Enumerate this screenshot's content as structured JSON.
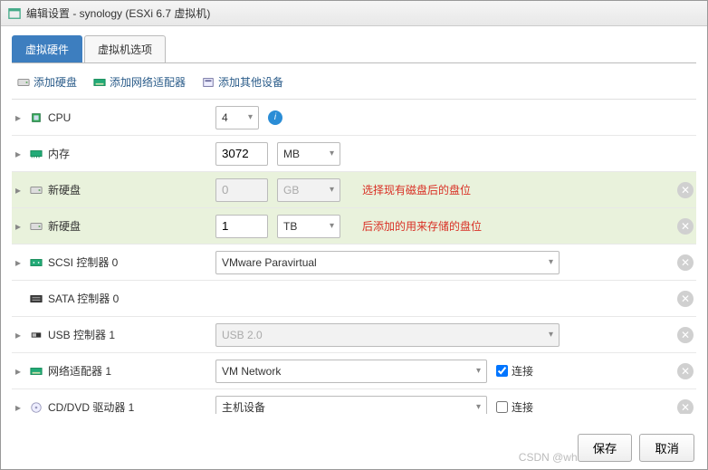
{
  "title": "编辑设置 - synology (ESXi 6.7 虚拟机)",
  "tabs": {
    "hardware": "虚拟硬件",
    "options": "虚拟机选项"
  },
  "toolbar": {
    "add_disk": "添加硬盘",
    "add_nic": "添加网络适配器",
    "add_other": "添加其他设备"
  },
  "rows": {
    "cpu": {
      "label": "CPU",
      "value": "4"
    },
    "mem": {
      "label": "内存",
      "value": "3072",
      "unit": "MB"
    },
    "disk1": {
      "label": "新硬盘",
      "value": "0",
      "unit": "GB",
      "note": "选择现有磁盘后的盘位"
    },
    "disk2": {
      "label": "新硬盘",
      "value": "1",
      "unit": "TB",
      "note": "后添加的用来存储的盘位"
    },
    "scsi": {
      "label": "SCSI 控制器 0",
      "value": "VMware Paravirtual"
    },
    "sata": {
      "label": "SATA 控制器 0"
    },
    "usb": {
      "label": "USB 控制器 1",
      "value": "USB 2.0"
    },
    "nic": {
      "label": "网络适配器 1",
      "value": "VM Network",
      "connect": "连接"
    },
    "cd": {
      "label": "CD/DVD 驱动器 1",
      "value": "主机设备",
      "connect": "连接"
    }
  },
  "buttons": {
    "save": "保存",
    "cancel": "取消"
  },
  "watermark": "CSDN @what..?"
}
